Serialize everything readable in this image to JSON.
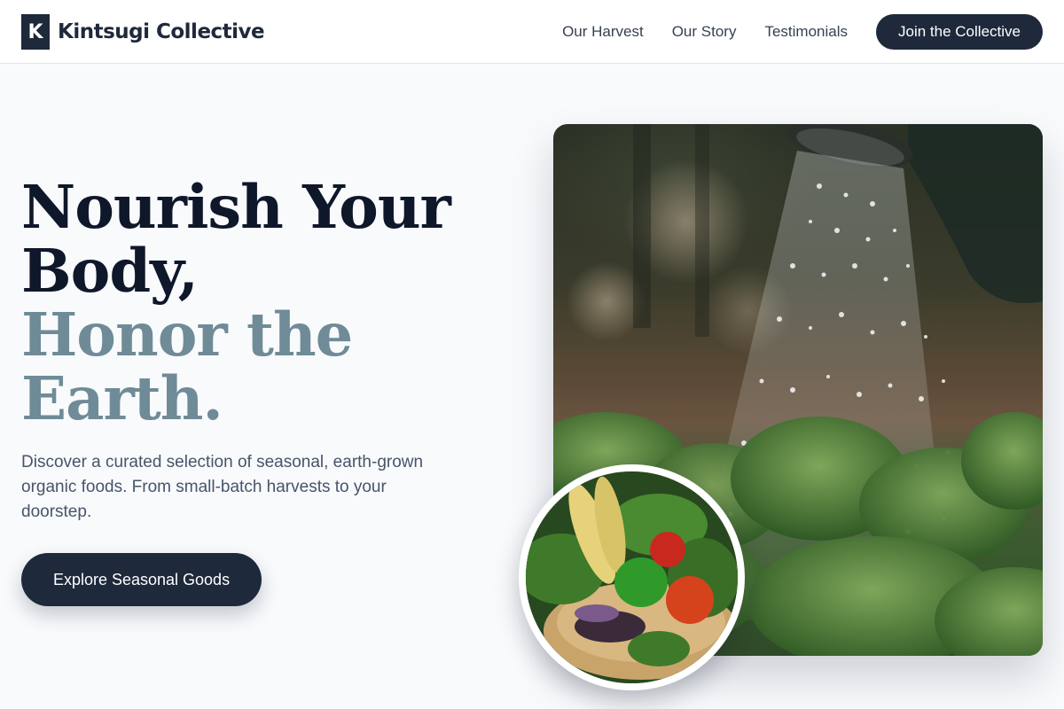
{
  "brand": {
    "logo_letter": "K",
    "name": "Kintsugi Collective"
  },
  "nav": {
    "links": [
      "Our Harvest",
      "Our Story",
      "Testimonials"
    ],
    "cta_label": "Join the Collective"
  },
  "hero": {
    "title_line1": "Nourish Your",
    "title_line2": "Body,",
    "title_line3": "Honor the",
    "title_line4": "Earth.",
    "description": "Discover a curated selection of seasonal, earth-grown organic foods. From small-batch harvests to your doorstep.",
    "cta_label": "Explore Seasonal Goods"
  },
  "images": {
    "main": "watering-can-garden-photo",
    "inset": "vegetable-basket-photo"
  },
  "colors": {
    "primary": "#1e293b",
    "title_dark": "#0f172a",
    "title_muted": "#6f8b97",
    "body_text": "#475569",
    "background": "#f8fafc"
  }
}
